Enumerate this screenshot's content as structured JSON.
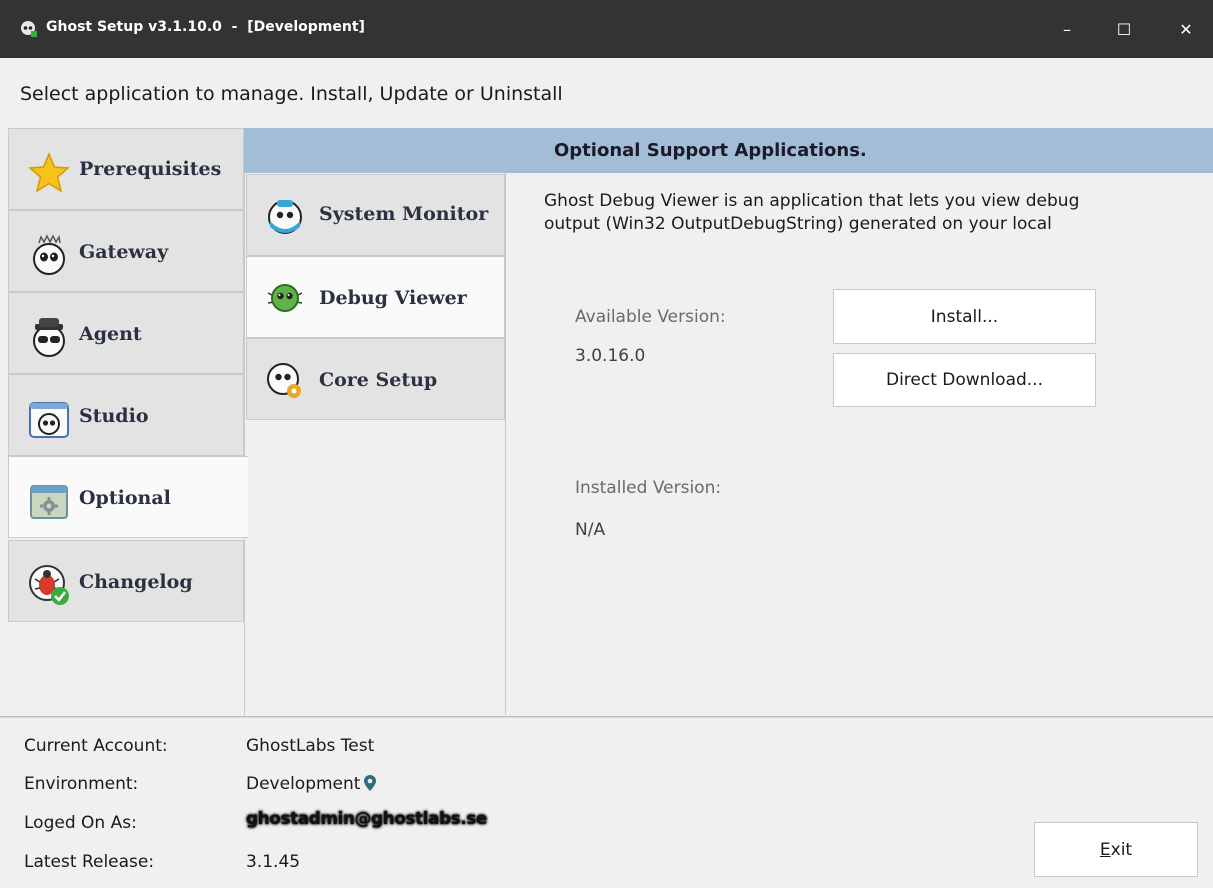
{
  "window": {
    "title": "Ghost Setup v3.1.10.0  -  [Development]",
    "min_glyph": "–",
    "max_glyph": "☐",
    "close_glyph": "✕"
  },
  "instruction": "Select application to manage. Install, Update or Uninstall",
  "main_tabs": [
    {
      "label": "Prerequisites",
      "icon": "star-icon"
    },
    {
      "label": "Gateway",
      "icon": "ghost-gateway-icon"
    },
    {
      "label": "Agent",
      "icon": "ghost-agent-icon"
    },
    {
      "label": "Studio",
      "icon": "ghost-studio-icon"
    },
    {
      "label": "Optional",
      "icon": "gear-window-icon",
      "active": true
    },
    {
      "label": "Changelog",
      "icon": "bug-check-icon"
    }
  ],
  "panel": {
    "header": "Optional Support Applications.",
    "sub_tabs": [
      {
        "label": "System Monitor",
        "icon": "ghost-monitor-icon"
      },
      {
        "label": "Debug Viewer",
        "icon": "ghost-bug-icon",
        "active": true
      },
      {
        "label": "Core Setup",
        "icon": "ghost-core-icon"
      }
    ],
    "description_line1": "Ghost Debug Viewer is an application that lets you view debug",
    "description_line2": "output (Win32 OutputDebugString) generated on your local",
    "available_label": "Available Version:",
    "available_value": "3.0.16.0",
    "installed_label": "Installed Version:",
    "installed_value": "N/A",
    "install_button": "Install...",
    "download_button": "Direct Download..."
  },
  "footer": {
    "account_label": "Current Account:",
    "account_value": "GhostLabs Test",
    "environment_label": "Environment:",
    "environment_value": "Development",
    "logon_label": "Loged On As:",
    "logon_value": "ghostadmin@ghostlabs.se",
    "release_label": "Latest Release:",
    "release_value": "3.1.45",
    "exit_button_prefix": "",
    "exit_button_mnemonic": "E",
    "exit_button_rest": "xit"
  },
  "colors": {
    "titlebar": "#333333",
    "header_bar": "#a3bdd6",
    "tab_inactive": "#e3e3e3",
    "tab_active": "#fafafa",
    "pin": "#2b6e80"
  }
}
